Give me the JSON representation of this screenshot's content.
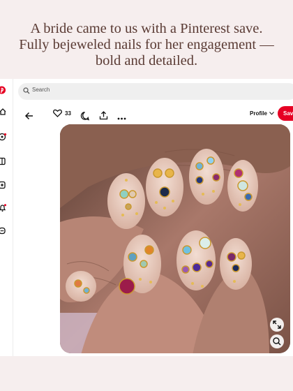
{
  "caption": {
    "line1": "A bride came to us with a Pinterest save.",
    "line2": "Fully bejeweled nails for her engagement —",
    "line3": "bold and detailed."
  },
  "search": {
    "placeholder": "Search"
  },
  "pin": {
    "likes": "33",
    "profile_label": "Profile",
    "save_label": "Save"
  },
  "colors": {
    "brand": "#e60023",
    "caption": "#5a3b34",
    "background": "#f6eeee"
  }
}
